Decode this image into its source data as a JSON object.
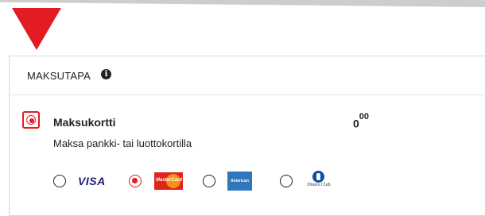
{
  "payment": {
    "section_title": "MAKSUTAPA",
    "info_icon": "info-circle-icon",
    "method": {
      "title": "Maksukortti",
      "description": "Maksa pankki- tai luottokortilla",
      "price_integer": "0",
      "price_decimals": "00",
      "selected": true
    },
    "cards": [
      {
        "name": "VISA",
        "selected": false
      },
      {
        "name": "MasterCard",
        "selected": true
      },
      {
        "name": "American Express",
        "selected": false
      },
      {
        "name": "Diners Club",
        "selected": false
      }
    ]
  },
  "colors": {
    "accent": "#e31b23",
    "border": "#d6d6d6",
    "text": "#222222"
  }
}
